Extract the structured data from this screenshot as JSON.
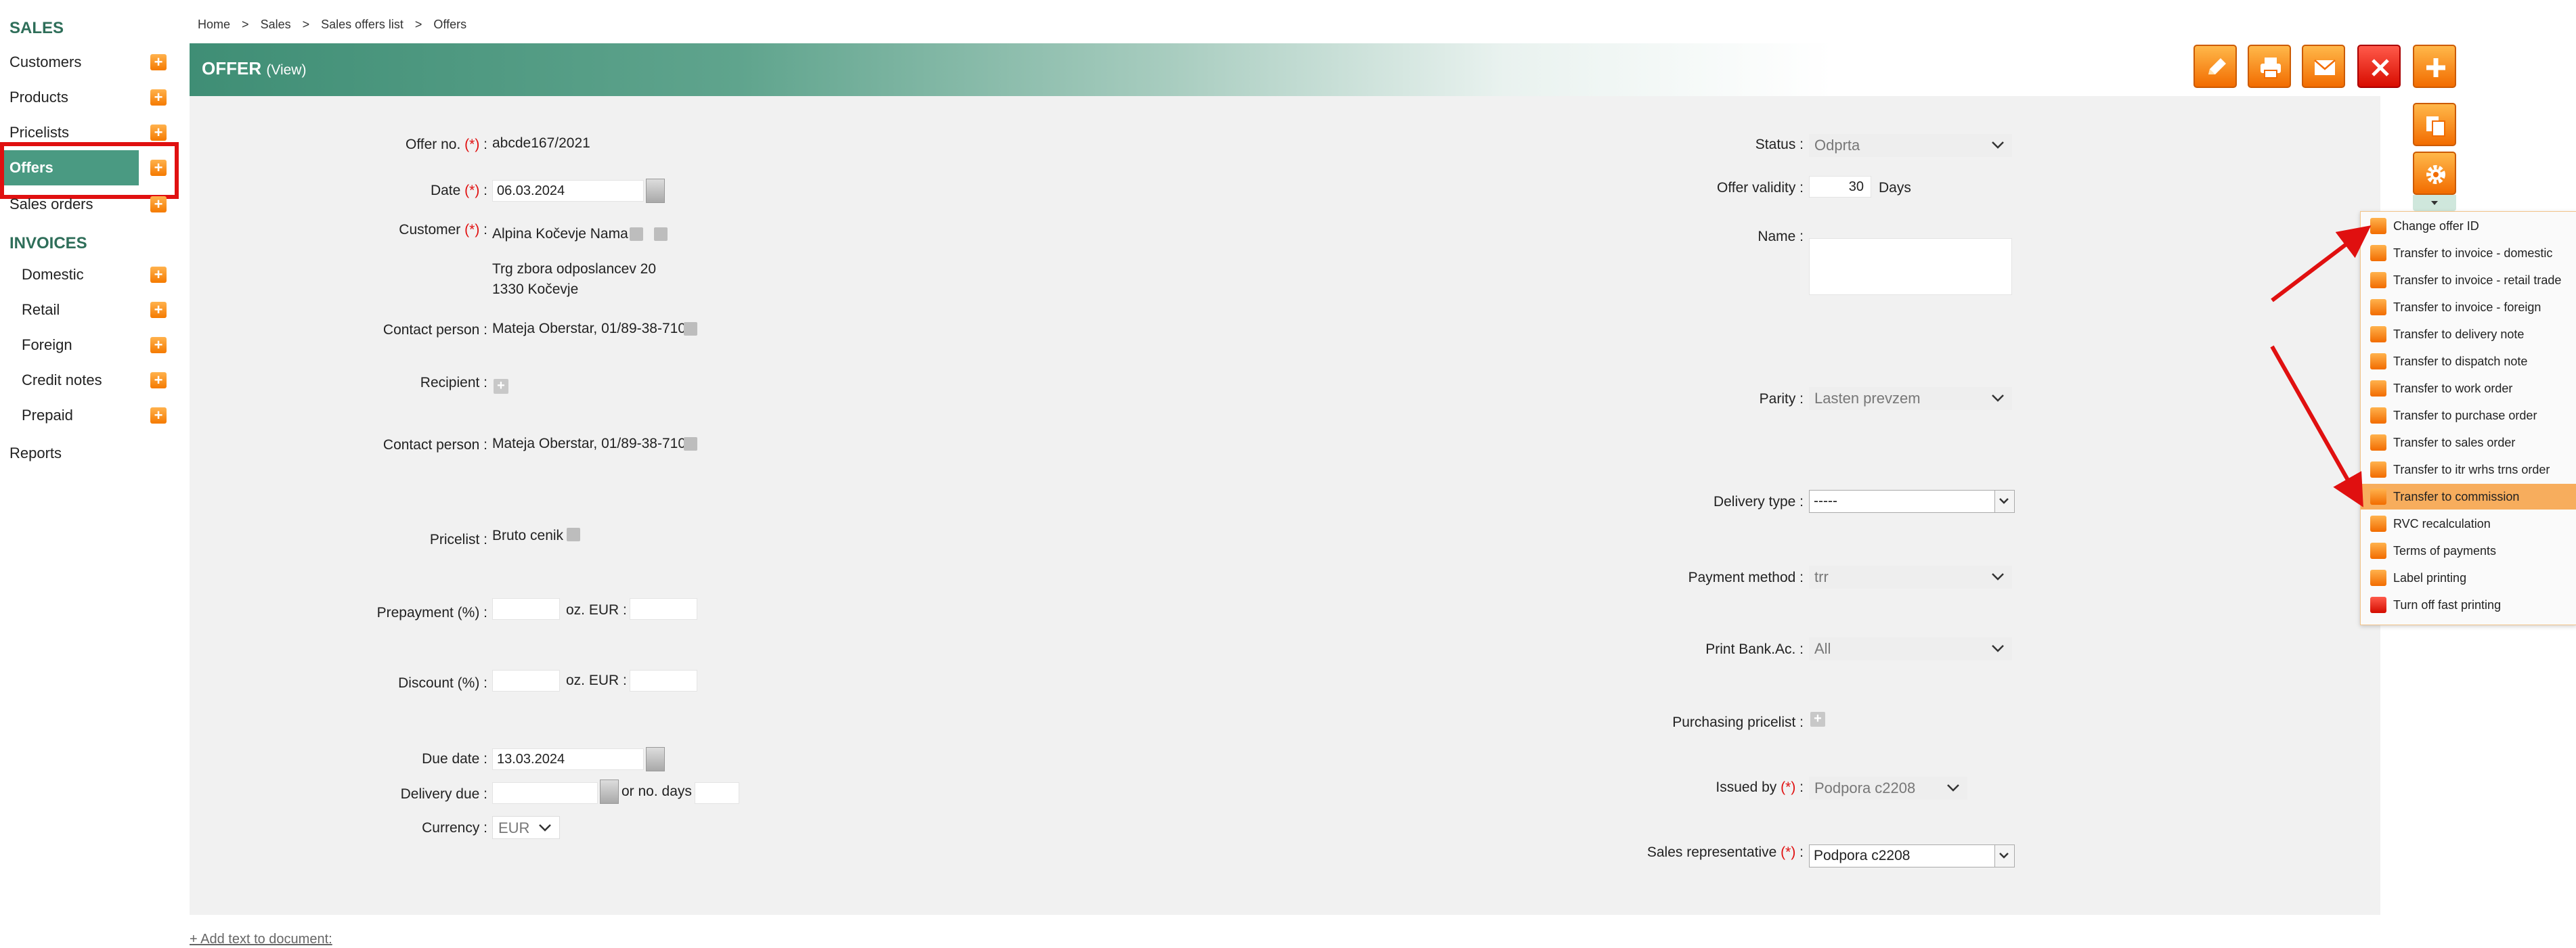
{
  "sidebar": {
    "sales_heading": "SALES",
    "sales_items": [
      {
        "label": "Customers"
      },
      {
        "label": "Products"
      },
      {
        "label": "Pricelists"
      },
      {
        "label": "Offers"
      },
      {
        "label": "Sales orders"
      }
    ],
    "invoices_heading": "INVOICES",
    "invoice_items": [
      {
        "label": "Domestic"
      },
      {
        "label": "Retail"
      },
      {
        "label": "Foreign"
      },
      {
        "label": "Credit notes"
      },
      {
        "label": "Prepaid"
      }
    ],
    "reports_label": "Reports",
    "plus_glyph": "+"
  },
  "breadcrumb": {
    "items": [
      "Home",
      "Sales",
      "Sales offers list",
      "Offers"
    ],
    "separator": ">"
  },
  "header": {
    "title": "OFFER",
    "mode": "(View)"
  },
  "form": {
    "required_mark": "(*)",
    "offer_no_label": "Offer no.",
    "offer_no_value": "abcde167/2021",
    "date_label": "Date",
    "date_value": "06.03.2024",
    "customer_label": "Customer",
    "customer_name": "Alpina Kočevje Nama",
    "customer_address1": "Trg zbora odposlancev 20",
    "customer_address2": "1330 Kočevje",
    "contact_person_label": "Contact person :",
    "contact_person_value": "Mateja Oberstar, 01/89-38-710",
    "recipient_label": "Recipient :",
    "contact_person2_label": "Contact person :",
    "contact_person2_value": "Mateja Oberstar, 01/89-38-710",
    "pricelist_label": "Pricelist :",
    "pricelist_value": "Bruto cenik",
    "prepayment_label": "Prepayment (%) :",
    "prepayment_eur_label": "oz. EUR :",
    "discount_label": "Discount (%) :",
    "discount_eur_label": "oz. EUR :",
    "due_date_label": "Due date :",
    "due_date_value": "13.03.2024",
    "delivery_due_label": "Delivery due :",
    "or_no_days_label": "or no. days",
    "currency_label": "Currency :",
    "currency_value": "EUR",
    "status_label": "Status :",
    "status_value": "Odprta",
    "offer_validity_label": "Offer validity :",
    "offer_validity_value": "30",
    "days_label": "Days",
    "name_label": "Name :",
    "parity_label": "Parity :",
    "parity_value": "Lasten prevzem",
    "delivery_type_label": "Delivery type :",
    "delivery_type_value": "-----",
    "payment_method_label": "Payment method :",
    "payment_method_value": "trr",
    "print_bank_label": "Print Bank.Ac. :",
    "print_bank_value": "All",
    "purchasing_pricelist_label": "Purchasing pricelist :",
    "issued_by_label": "Issued by",
    "issued_by_value": "Podpora c2208",
    "sales_rep_label": "Sales representative",
    "sales_rep_value": "Podpora c2208"
  },
  "menu": {
    "items": [
      {
        "label": "Change offer ID"
      },
      {
        "label": "Transfer to invoice - domestic"
      },
      {
        "label": "Transfer to invoice - retail trade"
      },
      {
        "label": "Transfer to invoice - foreign"
      },
      {
        "label": "Transfer to delivery note"
      },
      {
        "label": "Transfer to dispatch note"
      },
      {
        "label": "Transfer to work order"
      },
      {
        "label": "Transfer to purchase order"
      },
      {
        "label": "Transfer to sales order"
      },
      {
        "label": "Transfer to itr wrhs trns order"
      },
      {
        "label": "Transfer to commission"
      },
      {
        "label": "RVC recalculation"
      },
      {
        "label": "Terms of payments"
      },
      {
        "label": "Label printing"
      },
      {
        "label": "Turn off fast printing"
      }
    ]
  },
  "footer": {
    "add_text_link": "+ Add text to document:"
  },
  "colors": {
    "accent_green": "#4a9a82",
    "orange": "#f57a00",
    "highlight_red": "#e01010",
    "menu_highlight": "#f7ad5d"
  }
}
